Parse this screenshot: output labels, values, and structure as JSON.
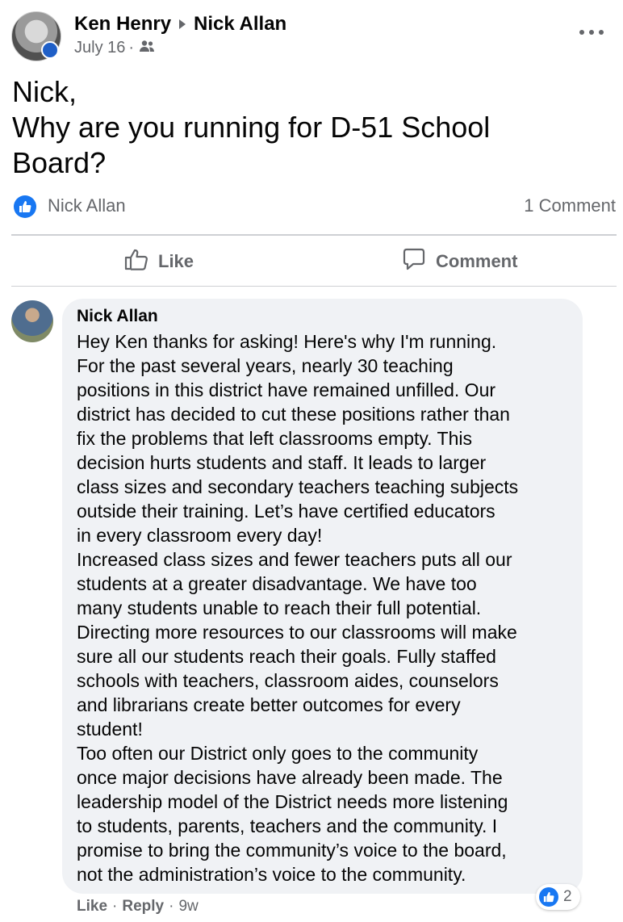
{
  "post": {
    "author": "Ken Henry",
    "recipient": "Nick Allan",
    "date": "July 16",
    "audience_icon": "friends-icon",
    "text_lines": [
      "Nick,",
      "Why are you running for D-51 School",
      "Board?"
    ],
    "reactor": "Nick Allan",
    "comment_count": "1 Comment",
    "like_label": "Like",
    "comment_label": "Comment"
  },
  "comment": {
    "author": "Nick Allan",
    "lines": [
      "Hey Ken thanks for asking! Here's why I'm running.",
      "For the past several years, nearly 30 teaching",
      "positions in this district have remained unfilled. Our",
      "district has decided to cut these positions rather than",
      "fix the problems that left classrooms empty. This",
      "decision hurts students and staff. It leads to larger",
      "class sizes and secondary teachers teaching subjects",
      "outside their training. Let’s have certified educators",
      "in every classroom every day!",
      "Increased class sizes and fewer teachers puts all our",
      "students at a greater disadvantage. We have too",
      "many students unable to reach their full potential.",
      "Directing more resources to our classrooms will make",
      "sure all our students reach their goals. Fully staffed",
      "schools with teachers, classroom aides, counselors",
      "and librarians create better outcomes for every",
      "student!",
      "Too often our District only goes to the community",
      "once major decisions have already been made. The",
      "leadership model of the District needs more listening",
      "to students, parents, teachers and the community. I",
      "promise to bring the community’s voice to the board,",
      "not the administration’s voice to the community."
    ],
    "like_label": "Like",
    "reply_label": "Reply",
    "time": "9w",
    "reaction_count": "2"
  },
  "colors": {
    "accent": "#1877f2",
    "muted": "#65676b",
    "bubble": "#f0f2f5"
  }
}
